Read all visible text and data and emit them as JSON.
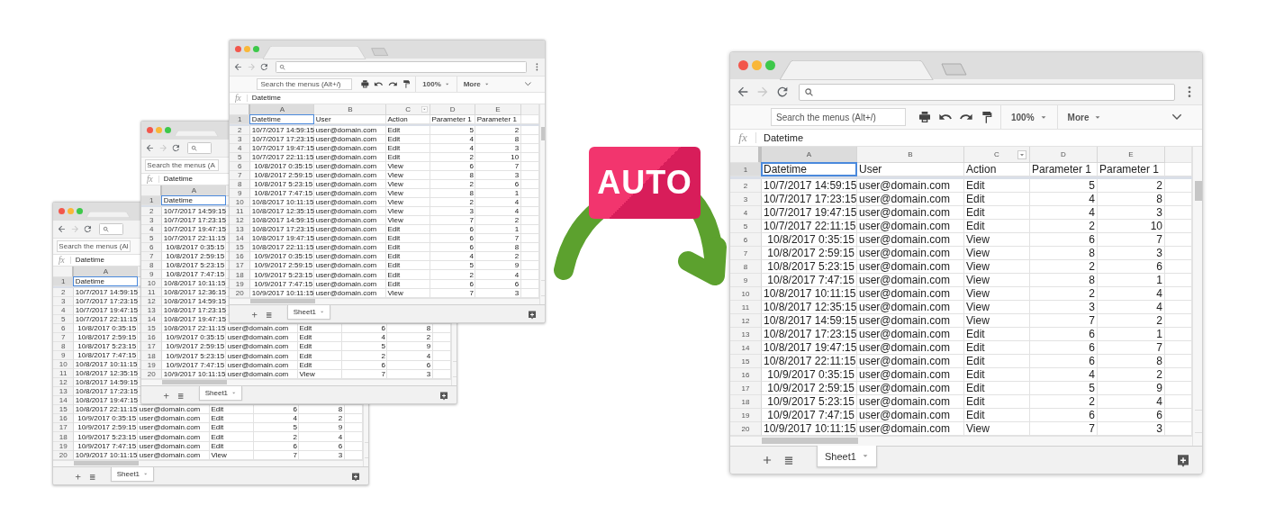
{
  "badge": "AUTO",
  "windows": [
    {
      "kind": "small",
      "full_chrome": false,
      "menu_search": {
        "placeholder": "Search the menus (Al"
      },
      "formula_label": "fx",
      "formula": "Datetime",
      "columns": [
        {
          "label": "A",
          "selected": true,
          "filter": false
        }
      ],
      "sheet_tab": "Sheet1",
      "rows": [
        {
          "n": "1",
          "selected": true,
          "cells": [
            "Datetime"
          ]
        },
        {
          "n": "2",
          "selected": false,
          "cells": [
            "10/7/2017 14:59:15"
          ]
        },
        {
          "n": "3",
          "selected": false,
          "cells": [
            "10/7/2017 17:23:15"
          ]
        },
        {
          "n": "4",
          "selected": false,
          "cells": [
            "10/7/2017 19:47:15"
          ]
        },
        {
          "n": "5",
          "selected": false,
          "cells": [
            "10/7/2017 22:11:15"
          ]
        },
        {
          "n": "6",
          "selected": false,
          "cells": [
            "10/8/2017 0:35:15"
          ]
        },
        {
          "n": "7",
          "selected": false,
          "cells": [
            "10/8/2017 2:59:15"
          ]
        },
        {
          "n": "8",
          "selected": false,
          "cells": [
            "10/8/2017 5:23:15"
          ]
        },
        {
          "n": "9",
          "selected": false,
          "cells": [
            "10/8/2017 7:47:15"
          ]
        },
        {
          "n": "10",
          "selected": false,
          "cells": [
            "10/8/2017 10:11:15"
          ]
        },
        {
          "n": "11",
          "selected": false,
          "cells": [
            "10/8/2017 12:35:15"
          ]
        },
        {
          "n": "12",
          "selected": false,
          "cells": [
            "10/8/2017 14:59:15"
          ]
        },
        {
          "n": "13",
          "selected": false,
          "cells": [
            "10/8/2017 17:23:15"
          ]
        },
        {
          "n": "14",
          "selected": false,
          "cells": [
            "10/8/2017 19:47:15"
          ]
        },
        {
          "n": "15",
          "selected": false,
          "cells": [
            "10/8/2017 22:11:15",
            "user@domain.com",
            "Edit",
            "6",
            "8"
          ]
        },
        {
          "n": "16",
          "selected": false,
          "cells": [
            "10/9/2017 0:35:15",
            "user@domain.com",
            "Edit",
            "4",
            "2"
          ]
        },
        {
          "n": "17",
          "selected": false,
          "cells": [
            "10/9/2017 2:59:15",
            "user@domain.com",
            "Edit",
            "5",
            "9"
          ]
        },
        {
          "n": "18",
          "selected": false,
          "cells": [
            "10/9/2017 5:23:15",
            "user@domain.com",
            "Edit",
            "2",
            "4"
          ]
        },
        {
          "n": "19",
          "selected": false,
          "cells": [
            "10/9/2017 7:47:15",
            "user@domain.com",
            "Edit",
            "6",
            "6"
          ]
        },
        {
          "n": "20",
          "selected": false,
          "cells": [
            "10/9/2017 10:11:15",
            "user@domain.com",
            "View",
            "7",
            "3"
          ]
        }
      ]
    },
    {
      "kind": "small",
      "full_chrome": false,
      "menu_search": {
        "placeholder": "Search the menus (A"
      },
      "formula_label": "fx",
      "formula": "Datetime",
      "columns": [
        {
          "label": "A",
          "selected": true,
          "filter": false
        }
      ],
      "sheet_tab": "Sheet1",
      "rows": [
        {
          "n": "1",
          "selected": true,
          "cells": [
            "Datetime"
          ]
        },
        {
          "n": "2",
          "selected": false,
          "cells": [
            "10/7/2017 14:59:15"
          ]
        },
        {
          "n": "3",
          "selected": false,
          "cells": [
            "10/7/2017 17:23:15"
          ]
        },
        {
          "n": "4",
          "selected": false,
          "cells": [
            "10/7/2017 19:47:15"
          ]
        },
        {
          "n": "5",
          "selected": false,
          "cells": [
            "10/7/2017 22:11:15"
          ]
        },
        {
          "n": "6",
          "selected": false,
          "cells": [
            "10/8/2017 0:35:15"
          ]
        },
        {
          "n": "7",
          "selected": false,
          "cells": [
            "10/8/2017 2:59:15"
          ]
        },
        {
          "n": "8",
          "selected": false,
          "cells": [
            "10/8/2017 5:23:15"
          ]
        },
        {
          "n": "9",
          "selected": false,
          "cells": [
            "10/8/2017 7:47:15"
          ]
        },
        {
          "n": "10",
          "selected": false,
          "cells": [
            "10/8/2017 10:11:15"
          ]
        },
        {
          "n": "11",
          "selected": false,
          "cells": [
            "10/8/2017 12:36:15"
          ]
        },
        {
          "n": "12",
          "selected": false,
          "cells": [
            "10/8/2017 14:59:15"
          ]
        },
        {
          "n": "13",
          "selected": false,
          "cells": [
            "10/8/2017 17:23:15"
          ]
        },
        {
          "n": "14",
          "selected": false,
          "cells": [
            "10/8/2017 19:47:15"
          ]
        },
        {
          "n": "15",
          "selected": false,
          "cells": [
            "10/8/2017 22:11:15",
            "user@domain.com",
            "Edit",
            "6",
            "8"
          ]
        },
        {
          "n": "16",
          "selected": false,
          "cells": [
            "10/9/2017 0:35:15",
            "user@domain.com",
            "Edit",
            "4",
            "2"
          ]
        },
        {
          "n": "17",
          "selected": false,
          "cells": [
            "10/9/2017 2:59:15",
            "user@domain.com",
            "Edit",
            "5",
            "9"
          ]
        },
        {
          "n": "18",
          "selected": false,
          "cells": [
            "10/9/2017 5:23:15",
            "user@domain.com",
            "Edit",
            "2",
            "4"
          ]
        },
        {
          "n": "19",
          "selected": false,
          "cells": [
            "10/9/2017 7:47:15",
            "user@domain.com",
            "Edit",
            "6",
            "6"
          ]
        },
        {
          "n": "20",
          "selected": false,
          "cells": [
            "10/9/2017 10:11:15",
            "user@domain.com",
            "View",
            "7",
            "3"
          ]
        }
      ]
    },
    {
      "kind": "small",
      "full_chrome": true,
      "menu_search": {
        "placeholder": "Search the menus (Alt+/)"
      },
      "zoom": "100%",
      "more": "More",
      "formula_label": "fx",
      "formula": "Datetime",
      "columns": [
        {
          "label": "A",
          "selected": true,
          "filter": false
        },
        {
          "label": "B",
          "selected": false,
          "filter": false
        },
        {
          "label": "C",
          "selected": false,
          "filter": true
        },
        {
          "label": "D",
          "selected": false,
          "filter": false
        },
        {
          "label": "E",
          "selected": false,
          "filter": false
        }
      ],
      "sheet_tab": "Sheet1",
      "rows": [
        {
          "n": "1",
          "selected": true,
          "cells": [
            "Datetime",
            "User",
            "Action",
            "Parameter 1",
            "Parameter 1"
          ]
        },
        {
          "n": "2",
          "selected": false,
          "cells": [
            "10/7/2017 14:59:15",
            "user@domain.com",
            "Edit",
            "5",
            "2"
          ]
        },
        {
          "n": "3",
          "selected": false,
          "cells": [
            "10/7/2017 17:23:15",
            "user@domain.com",
            "Edit",
            "4",
            "8"
          ]
        },
        {
          "n": "4",
          "selected": false,
          "cells": [
            "10/7/2017 19:47:15",
            "user@domain.com",
            "Edit",
            "4",
            "3"
          ]
        },
        {
          "n": "5",
          "selected": false,
          "cells": [
            "10/7/2017 22:11:15",
            "user@domain.com",
            "Edit",
            "2",
            "10"
          ]
        },
        {
          "n": "6",
          "selected": false,
          "cells": [
            "10/8/2017 0:35:15",
            "user@domain.com",
            "View",
            "6",
            "7"
          ]
        },
        {
          "n": "7",
          "selected": false,
          "cells": [
            "10/8/2017 2:59:15",
            "user@domain.com",
            "View",
            "8",
            "3"
          ]
        },
        {
          "n": "8",
          "selected": false,
          "cells": [
            "10/8/2017 5:23:15",
            "user@domain.com",
            "View",
            "2",
            "6"
          ]
        },
        {
          "n": "9",
          "selected": false,
          "cells": [
            "10/8/2017 7:47:15",
            "user@domain.com",
            "View",
            "8",
            "1"
          ]
        },
        {
          "n": "10",
          "selected": false,
          "cells": [
            "10/8/2017 10:11:15",
            "user@domain.com",
            "View",
            "2",
            "4"
          ]
        },
        {
          "n": "11",
          "selected": false,
          "cells": [
            "10/8/2017 12:35:15",
            "user@domain.com",
            "View",
            "3",
            "4"
          ]
        },
        {
          "n": "12",
          "selected": false,
          "cells": [
            "10/8/2017 14:59:15",
            "user@domain.com",
            "View",
            "7",
            "2"
          ]
        },
        {
          "n": "13",
          "selected": false,
          "cells": [
            "10/8/2017 17:23:15",
            "user@domain.com",
            "Edit",
            "6",
            "1"
          ]
        },
        {
          "n": "14",
          "selected": false,
          "cells": [
            "10/8/2017 19:47:15",
            "user@domain.com",
            "Edit",
            "6",
            "7"
          ]
        },
        {
          "n": "15",
          "selected": false,
          "cells": [
            "10/8/2017 22:11:15",
            "user@domain.com",
            "Edit",
            "6",
            "8"
          ]
        },
        {
          "n": "16",
          "selected": false,
          "cells": [
            "10/9/2017 0:35:15",
            "user@domain.com",
            "Edit",
            "4",
            "2"
          ]
        },
        {
          "n": "17",
          "selected": false,
          "cells": [
            "10/9/2017 2:59:15",
            "user@domain.com",
            "Edit",
            "5",
            "9"
          ]
        },
        {
          "n": "18",
          "selected": false,
          "cells": [
            "10/9/2017 5:23:15",
            "user@domain.com",
            "Edit",
            "2",
            "4"
          ]
        },
        {
          "n": "19",
          "selected": false,
          "cells": [
            "10/9/2017 7:47:15",
            "user@domain.com",
            "Edit",
            "6",
            "6"
          ]
        },
        {
          "n": "20",
          "selected": false,
          "cells": [
            "10/9/2017 10:11:15",
            "user@domain.com",
            "View",
            "7",
            "3"
          ]
        }
      ]
    },
    {
      "kind": "large",
      "full_chrome": true,
      "menu_search": {
        "placeholder": "Search the menus (Alt+/)"
      },
      "zoom": "100%",
      "more": "More",
      "formula_label": "fx",
      "formula": "Datetime",
      "columns": [
        {
          "label": "A",
          "selected": true,
          "filter": false
        },
        {
          "label": "B",
          "selected": false,
          "filter": false
        },
        {
          "label": "C",
          "selected": false,
          "filter": true
        },
        {
          "label": "D",
          "selected": false,
          "filter": false
        },
        {
          "label": "E",
          "selected": false,
          "filter": false
        }
      ],
      "sheet_tab": "Sheet1",
      "rows": [
        {
          "n": "1",
          "selected": true,
          "cells": [
            "Datetime",
            "User",
            "Action",
            "Parameter 1",
            "Parameter 1"
          ]
        },
        {
          "n": "2",
          "selected": false,
          "cells": [
            "10/7/2017 14:59:15",
            "user@domain.com",
            "Edit",
            "5",
            "2"
          ]
        },
        {
          "n": "3",
          "selected": false,
          "cells": [
            "10/7/2017 17:23:15",
            "user@domain.com",
            "Edit",
            "4",
            "8"
          ]
        },
        {
          "n": "4",
          "selected": false,
          "cells": [
            "10/7/2017 19:47:15",
            "user@domain.com",
            "Edit",
            "4",
            "3"
          ]
        },
        {
          "n": "5",
          "selected": false,
          "cells": [
            "10/7/2017 22:11:15",
            "user@domain.com",
            "Edit",
            "2",
            "10"
          ]
        },
        {
          "n": "6",
          "selected": false,
          "cells": [
            "10/8/2017 0:35:15",
            "user@domain.com",
            "View",
            "6",
            "7"
          ]
        },
        {
          "n": "7",
          "selected": false,
          "cells": [
            "10/8/2017 2:59:15",
            "user@domain.com",
            "View",
            "8",
            "3"
          ]
        },
        {
          "n": "8",
          "selected": false,
          "cells": [
            "10/8/2017 5:23:15",
            "user@domain.com",
            "View",
            "2",
            "6"
          ]
        },
        {
          "n": "9",
          "selected": false,
          "cells": [
            "10/8/2017 7:47:15",
            "user@domain.com",
            "View",
            "8",
            "1"
          ]
        },
        {
          "n": "10",
          "selected": false,
          "cells": [
            "10/8/2017 10:11:15",
            "user@domain.com",
            "View",
            "2",
            "4"
          ]
        },
        {
          "n": "11",
          "selected": false,
          "cells": [
            "10/8/2017 12:35:15",
            "user@domain.com",
            "View",
            "3",
            "4"
          ]
        },
        {
          "n": "12",
          "selected": false,
          "cells": [
            "10/8/2017 14:59:15",
            "user@domain.com",
            "View",
            "7",
            "2"
          ]
        },
        {
          "n": "13",
          "selected": false,
          "cells": [
            "10/8/2017 17:23:15",
            "user@domain.com",
            "Edit",
            "6",
            "1"
          ]
        },
        {
          "n": "14",
          "selected": false,
          "cells": [
            "10/8/2017 19:47:15",
            "user@domain.com",
            "Edit",
            "6",
            "7"
          ]
        },
        {
          "n": "15",
          "selected": false,
          "cells": [
            "10/8/2017 22:11:15",
            "user@domain.com",
            "Edit",
            "6",
            "8"
          ]
        },
        {
          "n": "16",
          "selected": false,
          "cells": [
            "10/9/2017 0:35:15",
            "user@domain.com",
            "Edit",
            "4",
            "2"
          ]
        },
        {
          "n": "17",
          "selected": false,
          "cells": [
            "10/9/2017 2:59:15",
            "user@domain.com",
            "Edit",
            "5",
            "9"
          ]
        },
        {
          "n": "18",
          "selected": false,
          "cells": [
            "10/9/2017 5:23:15",
            "user@domain.com",
            "Edit",
            "2",
            "4"
          ]
        },
        {
          "n": "19",
          "selected": false,
          "cells": [
            "10/9/2017 7:47:15",
            "user@domain.com",
            "Edit",
            "6",
            "6"
          ]
        },
        {
          "n": "20",
          "selected": false,
          "cells": [
            "10/9/2017 10:11:15",
            "user@domain.com",
            "View",
            "7",
            "3"
          ]
        }
      ]
    }
  ]
}
